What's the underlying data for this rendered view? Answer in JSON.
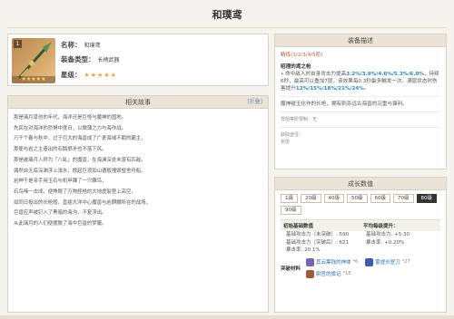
{
  "page": {
    "title": "和璞鸢"
  },
  "item": {
    "rarity_number": "1",
    "name_label": "名称：",
    "name_value": "和璞鸢",
    "type_label": "装备类型：",
    "type_value": "长柄武器",
    "stars_label": "星级：",
    "stars": "★★★★★",
    "thumb_stars": "★★★★★"
  },
  "story": {
    "title": "相关故事",
    "expand": "[折叠]",
    "paragraphs": [
      "那是璃月草创的年代，海洋还是巨怪与魔神的国地。",
      "先民在对海洋的恐惧中度日，以微薄之力与海作战。",
      "万千个春与秋中，过于巨大的海兽成了广袤海域不羁的霸主，",
      "那便与岩之主造出的石鹅掷矛也不落下风。",
      "那是被璃月人称为「八虬」的魔兽，在海渊深处未曾有匹敌。",
      "偶然自无底深渊浮上浅水，掀起巨浪如山德般撞毁璧舍舟船。",
      "岩神于是亲手用玉石与机甲雕了一只雕鸟，",
      "石鸟啼一击成，便挣脱了万物桎梏的大地虚裂登上高空，",
      "如同日投出的长枪般，直插大洋中心魔兽与岩麒麟所在的战场，",
      "巨兽应声被钉入了黑暗的海沟，不复浮出。",
      "从此璃月的人们便摆脱了海中巨兽的梦魇。"
    ]
  },
  "description": {
    "title": "装备描述",
    "refine_label": "精炼(1/2/3/4/5阶)",
    "skill_name": "昭理的鸢之枪",
    "skill_text_1": "• 命中敌人时自身攻击力提高",
    "skill_hl_1": "3.2%/3.9%/4.6%/5.3%/6.0%",
    "skill_text_2": "，持续6秒，最高可以叠加7层，该效果每0.3秒最多触发一次。满层状态时伤害提升",
    "skill_hl_2": "12%/15%/18%/21%/24%",
    "skill_text_3": "。",
    "lore": "魔神碰玉化作的长枪，拥有刺杀远古海兽的沉重与锋利。",
    "obtain_label": "冒险等阶限制：无",
    "source_label": "获取途径：",
    "source_value": "祈愿"
  },
  "growth": {
    "title": "成长数值",
    "levels": [
      "1级",
      "20级",
      "40级",
      "50级",
      "60级",
      "70级",
      "80级",
      "90级"
    ],
    "active_level": "80级",
    "left_header": "初始基础数值",
    "right_header": "平均每级提升：",
    "left_rows": [
      "基础攻击力（未突破）: 590",
      "基础攻击力（突破后）: 621",
      "暴击率: 20.1%"
    ],
    "right_rows": [
      "基础攻击力: +5.30",
      "暴击率: +0.20%"
    ],
    "materials_label": "突破材料",
    "materials": [
      {
        "name": "其云筹钱的神体",
        "count": "*6",
        "color": "#7b64b0"
      },
      {
        "name": "雾虚长昼刀",
        "count": "*27",
        "color": "#3d5da8"
      },
      {
        "name": "尉官的旗记",
        "count": "*18",
        "color": "#a15b3a"
      }
    ]
  }
}
